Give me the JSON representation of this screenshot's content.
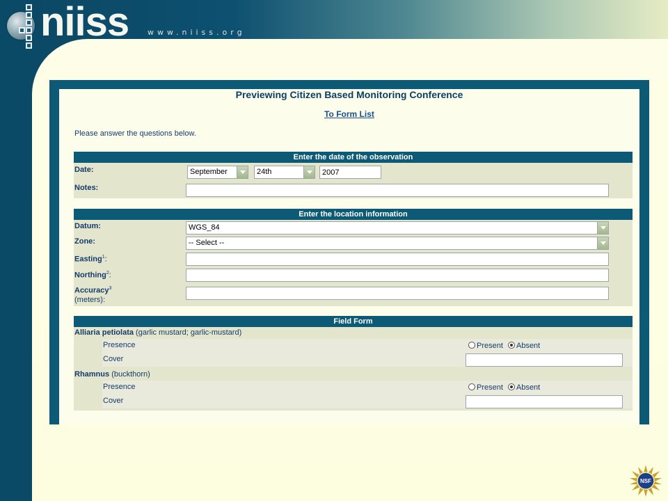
{
  "logo": {
    "text": "niiss",
    "url": "www.niiss.org"
  },
  "form": {
    "title": "Previewing Citizen Based Monitoring Conference",
    "back_link": "To Form List",
    "intro": "Please answer the questions below."
  },
  "date_section": {
    "heading": "Enter the date of the observation",
    "date_label": "Date:",
    "month": "September",
    "day": "24th",
    "year": "2007",
    "notes_label": "Notes:",
    "notes_value": ""
  },
  "location_section": {
    "heading": "Enter the location information",
    "datum_label": "Datum:",
    "datum_value": "WGS_84",
    "zone_label": "Zone:",
    "zone_value": "-- Select --",
    "easting_label": "Easting",
    "easting_sup": "1",
    "easting_suffix": ":",
    "northing_label": "Northing",
    "northing_sup": "2",
    "northing_suffix": ":",
    "accuracy_label": "Accuracy",
    "accuracy_sup": "3",
    "accuracy_sub": "(meters):"
  },
  "field_form": {
    "heading": "Field Form",
    "species": [
      {
        "name": "Alliaria petiolata",
        "common": "(garlic mustard; garlic-mustard)",
        "presence_label": "Presence",
        "present_label": "Present",
        "absent_label": "Absent",
        "selected": "Absent",
        "cover_label": "Cover",
        "cover_value": ""
      },
      {
        "name": "Rhamnus",
        "common": "(buckthorn)",
        "presence_label": "Presence",
        "present_label": "Present",
        "absent_label": "Absent",
        "selected": "Absent",
        "cover_label": "Cover",
        "cover_value": ""
      }
    ]
  },
  "colors": {
    "header_bar": "#0d5a76",
    "section_bg": "#e4e5cd",
    "title_text": "#0c3f66"
  },
  "icons": {
    "select_arrow": "chevron-down-icon",
    "seal": "nsf-seal-icon",
    "globe": "globe-icon"
  }
}
